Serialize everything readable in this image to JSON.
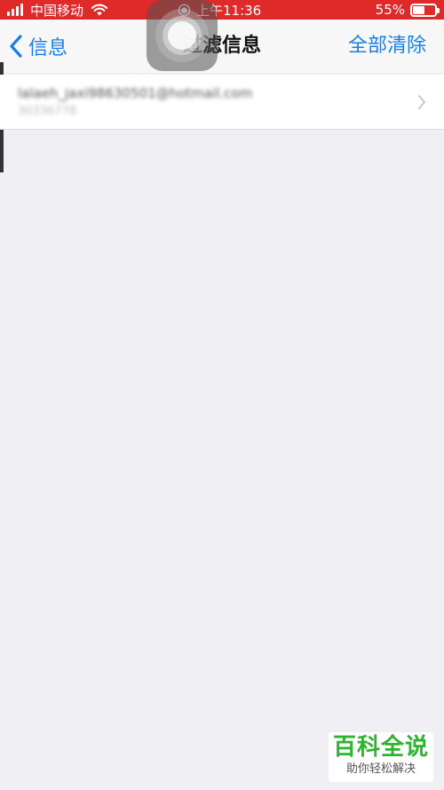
{
  "status_bar": {
    "carrier": "中国移动",
    "time": "上午11:36",
    "battery_percent_text": "55%",
    "battery_level": 0.55
  },
  "nav": {
    "back_label": "信息",
    "title": "过滤信息",
    "clear_all_label": "全部清除"
  },
  "list": {
    "items": [
      {
        "sender": "lalaeh_jaxi98630501@hotmail.com",
        "number": "30336778"
      }
    ]
  },
  "watermark": {
    "title": "百科全说",
    "subtitle": "助你轻松解决"
  },
  "colors": {
    "status_bar": "#e02a2a",
    "accent": "#1a7ee6",
    "background": "#efeff4",
    "watermark_green": "#2db52d"
  },
  "icons": {
    "signal": "signal-bars-icon",
    "wifi": "wifi-icon",
    "record": "screen-record-icon",
    "battery": "battery-icon",
    "back": "chevron-left-icon",
    "row": "chevron-right-icon",
    "assistive": "assistive-touch-icon"
  }
}
